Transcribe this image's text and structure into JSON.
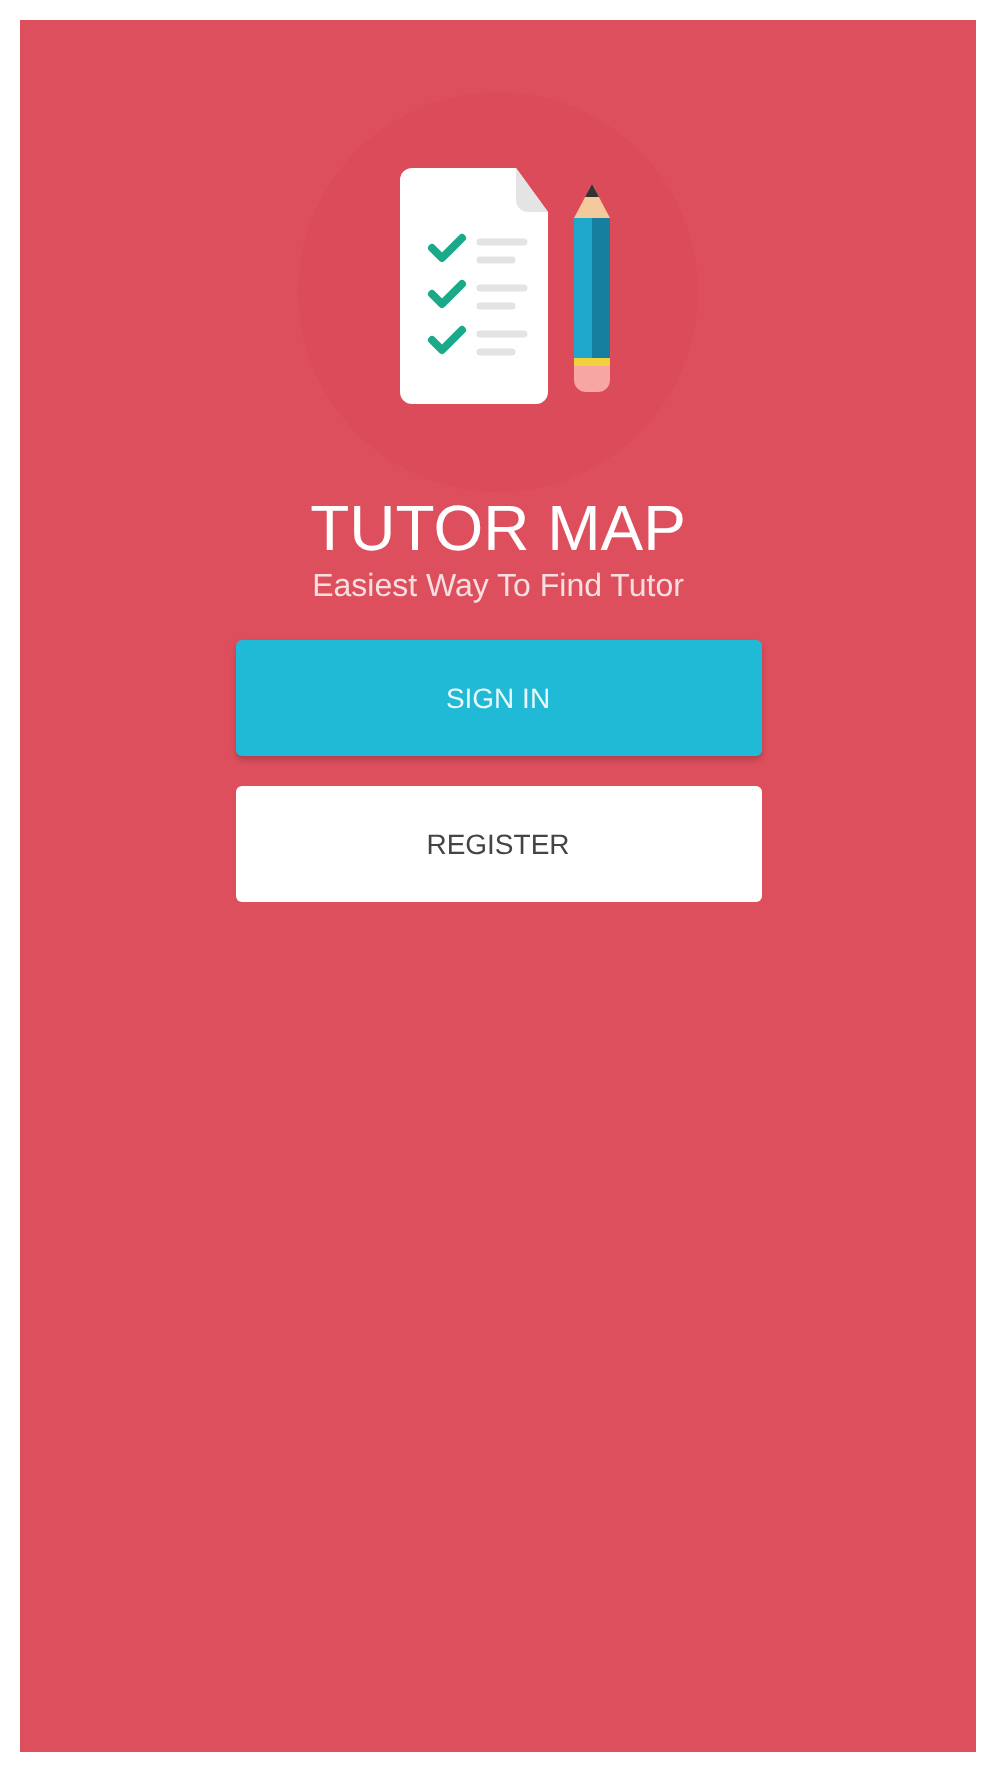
{
  "app": {
    "title": "TUTOR MAP",
    "tagline": "Easiest Way To Find Tutor"
  },
  "buttons": [
    {
      "label": "SIGN IN",
      "kind": "primary"
    },
    {
      "label": "REGISTER",
      "kind": "secondary"
    }
  ]
}
